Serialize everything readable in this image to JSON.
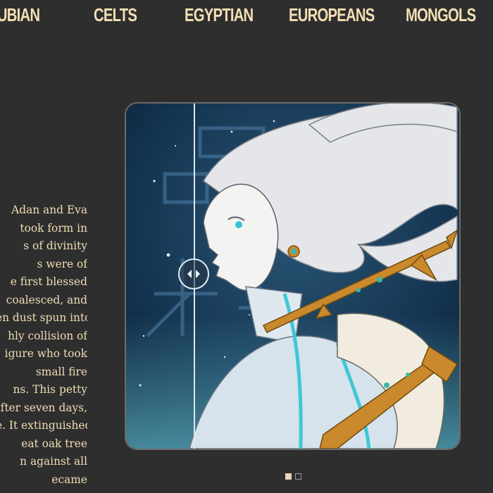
{
  "nav": {
    "items": [
      {
        "label": "NUBIAN"
      },
      {
        "label": "CELTS"
      },
      {
        "label": "EGYPTIAN"
      },
      {
        "label": "EUROPEANS"
      },
      {
        "label": "MONGOLS"
      }
    ]
  },
  "story": {
    "lines": [
      "Adan and Eva",
      "took form in",
      "s of divinity",
      "s were of",
      "e first blessed",
      "coalesced, and",
      "en dust spun into",
      "hly collision of",
      "igure who took",
      "small fire",
      "ns. This petty",
      "fter seven days,",
      "e. It extinguished",
      "eat oak tree",
      "n against all",
      "ecame"
    ]
  },
  "carousel": {
    "slide_count": 2,
    "active_index": 0
  },
  "icons": {
    "slider_handle": "left-right-arrows-icon"
  },
  "colors": {
    "background": "#2e2e2e",
    "accent_text": "#f3dfb4"
  }
}
